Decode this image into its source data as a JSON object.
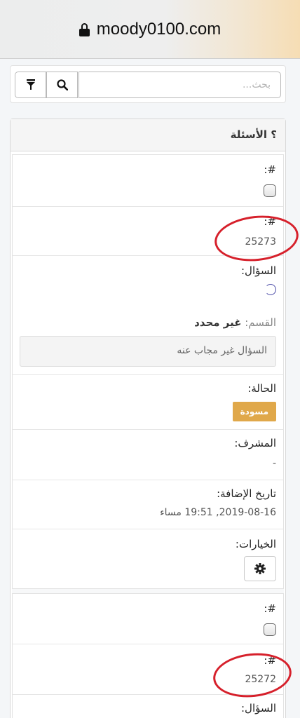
{
  "browser": {
    "url": "moody0100.com",
    "lock_icon": "lock-icon"
  },
  "search": {
    "placeholder": "بحث...",
    "filter_icon": "filter-icon",
    "search_icon": "search-icon"
  },
  "panel": {
    "title": "؟ الأسئلة"
  },
  "labels": {
    "id": "#:",
    "question": "السؤال:",
    "category": "القسم:",
    "status": "الحالة:",
    "supervisor": "المشرف:",
    "added_date": "تاريخ الإضافة:",
    "options": "الخيارات:"
  },
  "items": [
    {
      "id": "25273",
      "category_value": "غير محدد",
      "answer_note": "السؤال غير مجاب عنه",
      "status": "مسودة",
      "status_color": "#e0a84a",
      "supervisor": "-",
      "added_date": "2019-08-16, 19:51 مساء",
      "options_icon": "gear-icon"
    },
    {
      "id": "25272"
    }
  ],
  "colors": {
    "annotation": "#d6202b",
    "status_badge": "#e0a84a"
  }
}
